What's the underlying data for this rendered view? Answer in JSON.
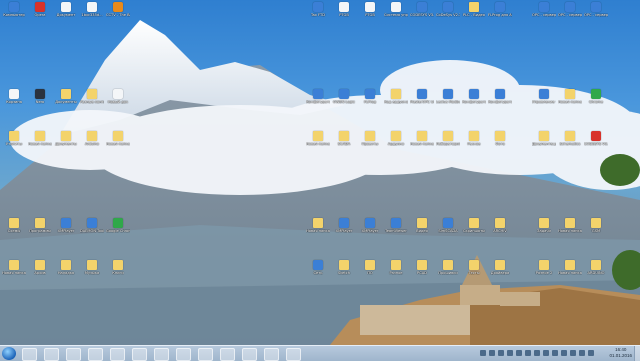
{
  "colors": {
    "taskbar": "#a9bdd3",
    "sky": "#3f8bd8",
    "folder": "#f3d36b"
  },
  "desktop_icons": [
    {
      "label": "Компьютер",
      "icon": "computer-icon",
      "kind": "app"
    },
    {
      "label": "Opera",
      "icon": "opera-icon",
      "kind": "red"
    },
    {
      "label": "Документ",
      "icon": "document-icon",
      "kind": "file"
    },
    {
      "label": "1bxc335d...",
      "icon": "file-icon",
      "kind": "file"
    },
    {
      "label": "CCTV - The Battle...",
      "icon": "video-icon",
      "kind": "orange"
    },
    {
      "label": "Tax FTD",
      "icon": "app-icon",
      "kind": "app"
    },
    {
      "label": "PTGB",
      "icon": "file-icon",
      "kind": "file"
    },
    {
      "label": "PTGB",
      "icon": "file-icon",
      "kind": "file"
    },
    {
      "label": "Система управления",
      "icon": "file-icon",
      "kind": "file"
    },
    {
      "label": "CODESYS V3.5 SP...",
      "icon": "codesys-icon",
      "kind": "app"
    },
    {
      "label": "CoDeSys V2.3",
      "icon": "codesys-icon",
      "kind": "app"
    },
    {
      "label": "PLC - Видео",
      "icon": "folder-icon",
      "kind": "folder"
    },
    {
      "label": "FLProg для Ардуино",
      "icon": "app-icon",
      "kind": "app"
    },
    {
      "label": "OPC - сервер для счёт...",
      "icon": "opc-icon",
      "kind": "app"
    },
    {
      "label": "OPC - сервер для Оборуд...",
      "icon": "opc-icon",
      "kind": "app"
    },
    {
      "label": "OPC - сервер для прибо...",
      "icon": "opc-icon",
      "kind": "app"
    },
    {
      "label": "Корзина",
      "icon": "recycle-bin-icon",
      "kind": "file"
    },
    {
      "label": "Nero",
      "icon": "nero-icon",
      "kind": "dark"
    },
    {
      "label": "Документы",
      "icon": "folder-icon",
      "kind": "folder"
    },
    {
      "label": "Разные контроллеры",
      "icon": "folder-icon",
      "kind": "folder"
    },
    {
      "label": "Новый док",
      "icon": "file-icon",
      "kind": "file"
    },
    {
      "label": "Конфигуратор",
      "icon": "app-icon",
      "kind": "app"
    },
    {
      "label": "OWEN Logic",
      "icon": "app-icon",
      "kind": "app"
    },
    {
      "label": "FLProg",
      "icon": "app-icon",
      "kind": "app"
    },
    {
      "label": "Код ардуино",
      "icon": "folder-icon",
      "kind": "folder"
    },
    {
      "label": "MasterOPC Universal...",
      "icon": "opc-icon",
      "kind": "app"
    },
    {
      "label": "Lectus Modbus O...",
      "icon": "app-icon",
      "kind": "app"
    },
    {
      "label": "Конфигуратор",
      "icon": "app-icon",
      "kind": "app"
    },
    {
      "label": "Конфигуратор",
      "icon": "app-icon",
      "kind": "app"
    },
    {
      "label": "Управление тепло...",
      "icon": "app-icon",
      "kind": "app"
    },
    {
      "label": "Новая папка",
      "icon": "folder-icon",
      "kind": "folder"
    },
    {
      "label": "Chrome",
      "icon": "chrome-icon",
      "kind": "green"
    },
    {
      "label": "Утилиты",
      "icon": "folder-icon",
      "kind": "folder"
    },
    {
      "label": "Новая папка",
      "icon": "folder-icon",
      "kind": "folder"
    },
    {
      "label": "Документы",
      "icon": "folder-icon",
      "kind": "folder"
    },
    {
      "label": "Arduino",
      "icon": "folder-icon",
      "kind": "folder"
    },
    {
      "label": "Новая папка",
      "icon": "folder-icon",
      "kind": "folder"
    },
    {
      "label": "Новая папка",
      "icon": "folder-icon",
      "kind": "folder"
    },
    {
      "label": "SCADA",
      "icon": "folder-icon",
      "kind": "folder"
    },
    {
      "label": "Проекты",
      "icon": "folder-icon",
      "kind": "folder"
    },
    {
      "label": "Ардуино",
      "icon": "folder-icon",
      "kind": "folder"
    },
    {
      "label": "Новая папка",
      "icon": "folder-icon",
      "kind": "folder"
    },
    {
      "label": "Лаборатория",
      "icon": "folder-icon",
      "kind": "folder"
    },
    {
      "label": "Разное",
      "icon": "folder-icon",
      "kind": "folder"
    },
    {
      "label": "Фото",
      "icon": "folder-icon",
      "kind": "folder"
    },
    {
      "label": "Документация",
      "icon": "folder-icon",
      "kind": "folder"
    },
    {
      "label": "Schematics",
      "icon": "folder-icon",
      "kind": "folder"
    },
    {
      "label": "CODESYS V3.5",
      "icon": "codesys-icon",
      "kind": "red"
    },
    {
      "label": "Схемы",
      "icon": "folder-icon",
      "kind": "folder"
    },
    {
      "label": "Программы",
      "icon": "folder-icon",
      "kind": "folder"
    },
    {
      "label": "XMPlayer",
      "icon": "player-icon",
      "kind": "app"
    },
    {
      "label": "DAEMON Tools Lite",
      "icon": "daemon-icon",
      "kind": "app"
    },
    {
      "label": "Google Chrome",
      "icon": "chrome-icon",
      "kind": "green"
    },
    {
      "label": "Новая папка",
      "icon": "folder-icon",
      "kind": "folder"
    },
    {
      "label": "XMPlayer",
      "icon": "player-icon",
      "kind": "app"
    },
    {
      "label": "XMPlayer",
      "icon": "player-icon",
      "kind": "app"
    },
    {
      "label": "TeamViewer",
      "icon": "teamviewer-icon",
      "kind": "app"
    },
    {
      "label": "Видео",
      "icon": "folder-icon",
      "kind": "folder"
    },
    {
      "label": "SimSCADA",
      "icon": "app-icon",
      "kind": "app"
    },
    {
      "label": "Скриншоты",
      "icon": "folder-icon",
      "kind": "folder"
    },
    {
      "label": "ARCHIV",
      "icon": "folder-icon",
      "kind": "folder"
    },
    {
      "label": "Задачи",
      "icon": "folder-icon",
      "kind": "folder"
    },
    {
      "label": "Новая папка",
      "icon": "folder-icon",
      "kind": "folder"
    },
    {
      "label": "GSM",
      "icon": "folder-icon",
      "kind": "folder"
    },
    {
      "label": "Новая папка",
      "icon": "folder-icon",
      "kind": "folder"
    },
    {
      "label": "Архив",
      "icon": "folder-icon",
      "kind": "folder"
    },
    {
      "label": "Наладка",
      "icon": "folder-icon",
      "kind": "folder"
    },
    {
      "label": "Музыка",
      "icon": "folder-icon",
      "kind": "folder"
    },
    {
      "label": "Книги",
      "icon": "folder-icon",
      "kind": "folder"
    },
    {
      "label": "Сеть",
      "icon": "network-icon",
      "kind": "app"
    },
    {
      "label": "Sketch",
      "icon": "folder-icon",
      "kind": "folder"
    },
    {
      "label": "ПО",
      "icon": "folder-icon",
      "kind": "folder"
    },
    {
      "label": "Разное",
      "icon": "folder-icon",
      "kind": "folder"
    },
    {
      "label": "PCAD",
      "icon": "folder-icon",
      "kind": "folder"
    },
    {
      "label": "Прошивки",
      "icon": "folder-icon",
      "kind": "folder"
    },
    {
      "label": "Тесты",
      "icon": "folder-icon",
      "kind": "folder"
    },
    {
      "label": "Драйвера",
      "icon": "folder-icon",
      "kind": "folder"
    },
    {
      "label": "Разное 2",
      "icon": "folder-icon",
      "kind": "folder"
    },
    {
      "label": "Новая папка",
      "icon": "folder-icon",
      "kind": "folder"
    },
    {
      "label": "ARDUINO",
      "icon": "folder-icon",
      "kind": "folder"
    }
  ],
  "taskbar": {
    "apps": [
      "explorer-icon",
      "media-player-icon",
      "chrome-icon",
      "opera-icon",
      "file-manager-icon",
      "owen-icon",
      "nero-icon",
      "app-icon",
      "scada-icon",
      "terminal-icon",
      "app-icon",
      "teamviewer-icon",
      "app-icon"
    ],
    "tray": [
      "arrow-up-icon",
      "network-icon",
      "volume-icon",
      "language-icon",
      "battery-icon",
      "shield-icon",
      "flag-icon",
      "monitor-icon",
      "clock-sync-icon",
      "antivirus-icon",
      "update-icon",
      "usb-icon",
      "cloud-icon"
    ],
    "clock_time": "16:40",
    "clock_date": "01.01.2016"
  }
}
